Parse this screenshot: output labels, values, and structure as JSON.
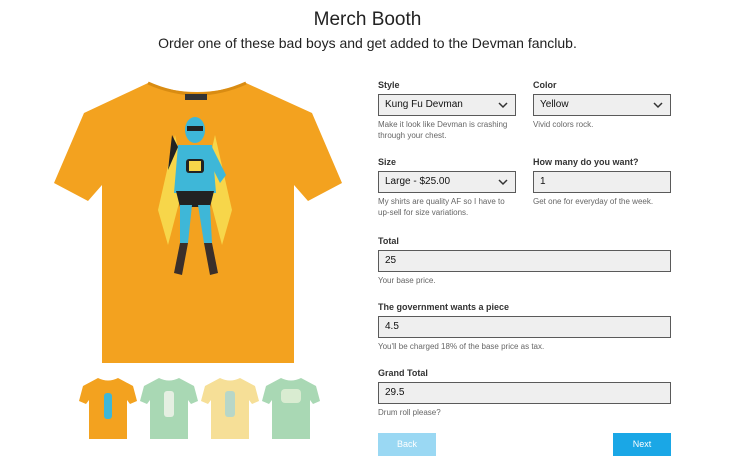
{
  "header": {
    "title": "Merch Booth",
    "subtitle": "Order one of these bad boys and get added to the Devman fanclub."
  },
  "colors": {
    "shirt_main": "#f3a21f",
    "thumb_shirts": [
      "#f3a21f",
      "#a9d8b4",
      "#f6df97",
      "#a9d8b4"
    ],
    "primary_button": "#1aa7e6",
    "disabled_button": "#9ad8f3",
    "field_bg": "#efefef"
  },
  "form": {
    "style": {
      "label": "Style",
      "value": "Kung Fu Devman",
      "help": "Make it look like Devman is crashing through your chest."
    },
    "color": {
      "label": "Color",
      "value": "Yellow",
      "help": "Vivid colors rock."
    },
    "size": {
      "label": "Size",
      "value": "Large - $25.00",
      "help": "My shirts are quality AF so I have to up-sell for size variations."
    },
    "quantity": {
      "label": "How many do you want?",
      "value": "1",
      "help": "Get one for everyday of the week."
    },
    "total": {
      "label": "Total",
      "value": "25",
      "help": "Your base price."
    },
    "tax": {
      "label": "The government wants a piece",
      "value": "4.5",
      "help": "You'll be charged 18% of the base price as tax."
    },
    "grand_total": {
      "label": "Grand Total",
      "value": "29.5",
      "help": "Drum roll please?"
    }
  },
  "buttons": {
    "back": "Back",
    "next": "Next"
  }
}
